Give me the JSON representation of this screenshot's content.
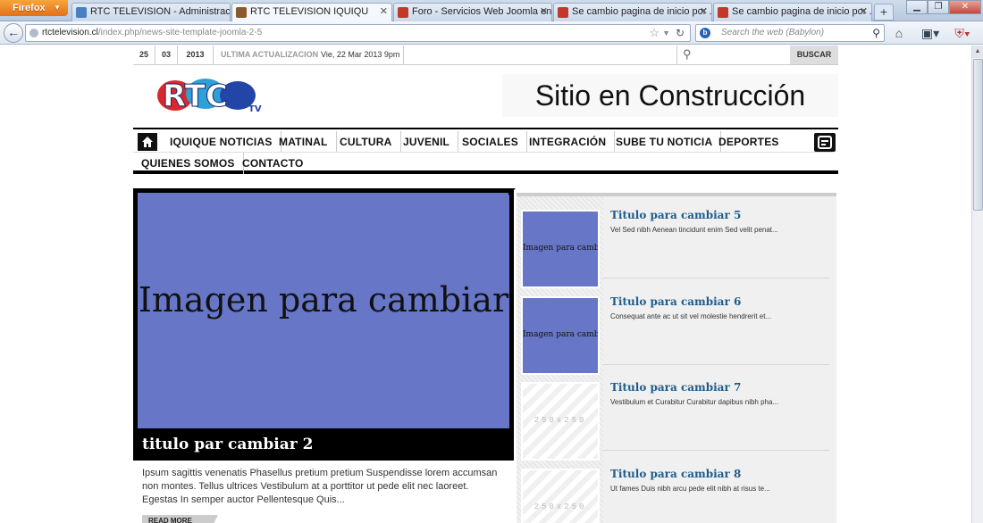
{
  "browser": {
    "app_button": "Firefox",
    "tabs": [
      {
        "label": "RTC TELEVISION - Administración",
        "favicon_color": "#4a7fc1"
      },
      {
        "label": "RTC TELEVISION IQUIQU",
        "favicon_color": "#8a5a2c"
      },
      {
        "label": "Foro - Servicios Web Joomla en ...",
        "favicon_color": "#c0392b"
      },
      {
        "label": "Se cambio pagina de inicio por ...",
        "favicon_color": "#c0392b"
      },
      {
        "label": "Se cambio pagina de inicio por ...",
        "favicon_color": "#c0392b"
      }
    ],
    "new_tab": "+",
    "url_domain": "rtctelevision.cl",
    "url_path": "/index.php/news-site-template-joomla-2-5",
    "search_placeholder": "Search the web (Babylon)",
    "search_engine_glyph": "b"
  },
  "site": {
    "date": {
      "day": "25",
      "month": "03",
      "year": "2013"
    },
    "last_update_label": "ULTIMA ACTUALIZACION",
    "last_update_value": "Vie, 22 Mar 2013 9pm",
    "search_button": "BUSCAR",
    "banner_text": "Sitio en Construcción",
    "logo": {
      "letters": "RTC",
      "suffix": "TV"
    },
    "nav": [
      "IQUIQUE NOTICIAS",
      "MATINAL",
      "CULTURA",
      "JUVENIL",
      "SOCIALES",
      "INTEGRACIÓN",
      "SUBE TU NOTICIA",
      "DEPORTES",
      "QUIENES SOMOS",
      "CONTACTO"
    ],
    "feature": {
      "image_text": "Imagen para cambiar",
      "title": "titulo par cambiar 2",
      "description": "Ipsum sagittis venenatis Phasellus pretium pretium Suspendisse lorem accumsan non montes. Tellus ultrices Vestibulum at a porttitor ut pede elit nec laoreet. Egestas In semper auctor Pellentesque Quis...",
      "read_more": "READ MORE"
    },
    "list": [
      {
        "title": "Titulo para cambiar 5",
        "desc": "Vel Sed nibh Aenean tincidunt enim Sed velit penat...",
        "thumb_text": "Imagen para cambiar"
      },
      {
        "title": "Titulo para cambiar 6",
        "desc": "Consequat ante ac ut sit vel molestie hendrerit et...",
        "thumb_text": "Imagen para cambiar"
      },
      {
        "title": "Titulo para cambiar 7",
        "desc": "Vestibulum et Curabitur Curabitur dapibus nibh pha...",
        "thumb_text": "250x250"
      },
      {
        "title": "Titulo para cambiar 8",
        "desc": "Ut fames Duis nibh arcu pede elit nibh at risus te...",
        "thumb_text": "250x250"
      }
    ]
  },
  "colors": {
    "feature_image": "#6776c7",
    "title_link": "#1d5c8c",
    "nav_border": "#000000"
  }
}
